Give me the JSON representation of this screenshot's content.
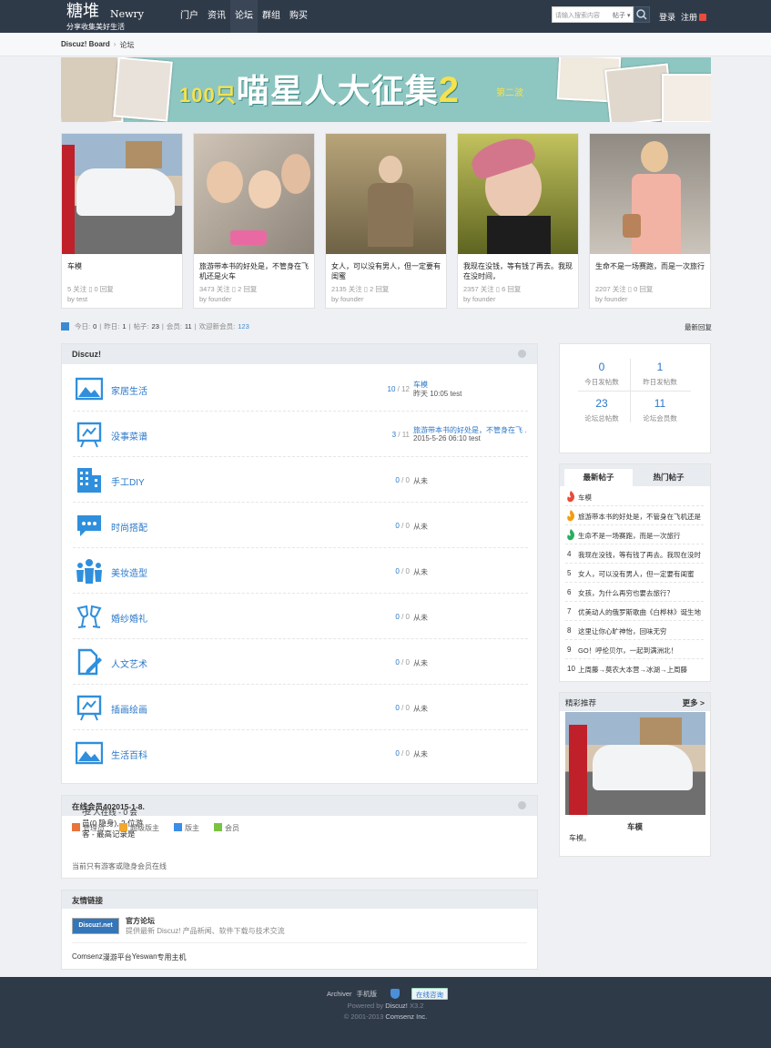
{
  "header": {
    "logo_main": "糖堆",
    "logo_en": "Newry",
    "logo_sub": "分享收集美好生活",
    "nav": [
      "门户",
      "资讯",
      "论坛",
      "群组",
      "购买"
    ],
    "search_placeholder": "请输入搜索内容",
    "search_type": "帖子",
    "login": "登录",
    "register": "注册"
  },
  "breadcrumb": {
    "home": "Discuz! Board",
    "sep": "›",
    "current": "论坛"
  },
  "banner": {
    "num": "100只",
    "text": "喵星人大征集",
    "big2": "2",
    "wave": "第二波"
  },
  "cards": [
    {
      "title": "车模",
      "meta1": "5 关注 ▯ 0 回复",
      "meta2": "by test"
    },
    {
      "title": "旅游带本书的好处是，不管身在飞机还是火车",
      "meta1": "3473 关注 ▯ 2 回复",
      "meta2": "by founder"
    },
    {
      "title": "女人，可以没有男人，但一定要有闺蜜",
      "meta1": "2135 关注 ▯ 2 回复",
      "meta2": "by founder"
    },
    {
      "title": "我现在没钱，等有钱了再去。我现在没时间，",
      "meta1": "2357 关注 ▯ 6 回复",
      "meta2": "by founder"
    },
    {
      "title": "生命不是一场赛跑，而是一次旅行",
      "meta1": "2207 关注 ▯ 0 回复",
      "meta2": "by founder"
    }
  ],
  "stats": {
    "today_l": "今日:",
    "today": "0",
    "yest_l": "昨日:",
    "yest": "1",
    "posts_l": "帖子:",
    "posts": "23",
    "members_l": "会员:",
    "members": "11",
    "welcome_l": "欢迎新会员:",
    "welcome": "123",
    "latest": "最新回复"
  },
  "forum": {
    "title": "Discuz!",
    "rows": [
      {
        "name": "家居生活",
        "today": "10",
        "total": "12",
        "last_title": "车模",
        "last_info": "昨天 10:05 test"
      },
      {
        "name": "没事菜谱",
        "today": "3",
        "total": "11",
        "last_title": "旅游带本书的好处是，不管身在飞 ...",
        "last_info": "2015-5-26 06:10 test"
      },
      {
        "name": "手工DIY",
        "today": "0",
        "total": "0",
        "never": "从未"
      },
      {
        "name": "时尚搭配",
        "today": "0",
        "total": "0",
        "never": "从未"
      },
      {
        "name": "美妆造型",
        "today": "0",
        "total": "0",
        "never": "从未"
      },
      {
        "name": "婚纱婚礼",
        "today": "0",
        "total": "0",
        "never": "从未"
      },
      {
        "name": "人文艺术",
        "today": "0",
        "total": "0",
        "never": "从未"
      },
      {
        "name": "插画绘画",
        "today": "0",
        "total": "0",
        "never": "从未"
      },
      {
        "name": "生活百科",
        "today": "0",
        "total": "0",
        "never": "从未"
      }
    ]
  },
  "online": {
    "title_a": "在线会员",
    "title_b": " - 2 人在线 - 0 会员(0 隐身), 2 位游客 - 最高记录是 ",
    "title_c": "40",
    "title_d": " 于 ",
    "title_e": "2015-1-8.",
    "legend": [
      "管理员",
      "超级版主",
      "版主",
      "会员"
    ],
    "legend_colors": [
      "#e8743b",
      "#f0a830",
      "#3a8ee6",
      "#7cc242"
    ],
    "note": "当前只有游客或隐身会员在线"
  },
  "links": {
    "title": "友情链接",
    "logo_text": "Discuz!.net",
    "name": "官方论坛",
    "desc": "提供最新 Discuz! 产品新闻、软件下载与技术交流",
    "items": [
      "Comsenz",
      "漫游平台",
      "Yeswan",
      "专用主机"
    ]
  },
  "rstats": [
    {
      "v": "0",
      "l": "今日发帖数"
    },
    {
      "v": "1",
      "l": "昨日发帖数"
    },
    {
      "v": "23",
      "l": "论坛总帖数"
    },
    {
      "v": "11",
      "l": "论坛会员数"
    }
  ],
  "hot": {
    "tab1": "最新帖子",
    "tab2": "热门帖子",
    "items": [
      {
        "n": "1",
        "t": "车模"
      },
      {
        "n": "2",
        "t": "旅游带本书的好处是，不管身在飞机还是"
      },
      {
        "n": "3",
        "t": "生命不是一场赛跑，而是一次旅行"
      },
      {
        "n": "4",
        "t": "我现在没钱，等有钱了再去。我现在没时"
      },
      {
        "n": "5",
        "t": "女人，可以没有男人，但一定要有闺蜜"
      },
      {
        "n": "6",
        "t": "女孩，为什么再穷也要去旅行？"
      },
      {
        "n": "7",
        "t": "优美动人的俄罗斯歌曲《白桦林》诞生地"
      },
      {
        "n": "8",
        "t": "这里让你心旷神怡，回味无穷"
      },
      {
        "n": "9",
        "t": "GO！呼伦贝尔，一起到满洲北！"
      },
      {
        "n": "10",
        "t": "上周藤→莫农大本营→冰湖→上周藤"
      }
    ],
    "fire_colors": [
      "#e74c3c",
      "#f39c12",
      "#27ae60"
    ]
  },
  "recommend": {
    "title": "精彩推荐",
    "more": "更多 >",
    "item_title": "车模",
    "item_desc": "车模。"
  },
  "footer": {
    "archiver": "Archiver",
    "mobile": "手机版",
    "chat": "在线咨询",
    "powered": "Powered by",
    "discuz": "Discuz!",
    "ver": "X3.2",
    "copy": "© 2001-2013",
    "company": "Comsenz Inc."
  }
}
